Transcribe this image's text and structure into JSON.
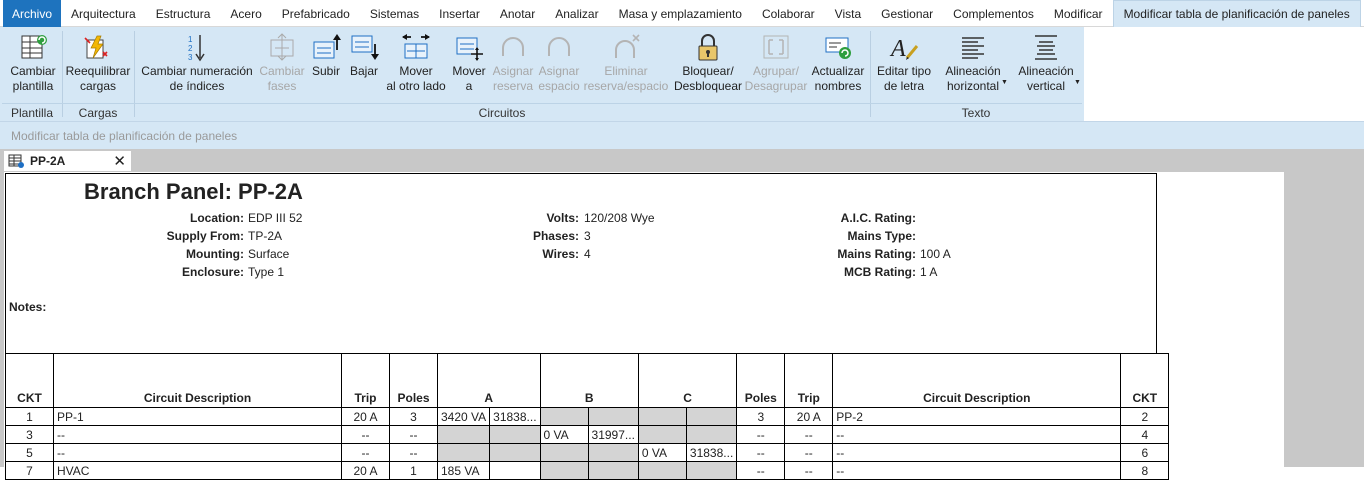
{
  "menu": {
    "tabs": [
      "Archivo",
      "Arquitectura",
      "Estructura",
      "Acero",
      "Prefabricado",
      "Sistemas",
      "Insertar",
      "Anotar",
      "Analizar",
      "Masa y emplazamiento",
      "Colaborar",
      "Vista",
      "Gestionar",
      "Complementos",
      "Modificar",
      "Modificar tabla de planificación de paneles"
    ]
  },
  "ribbon": {
    "buttons": {
      "cambiar_plantilla": [
        "Cambiar",
        "plantilla"
      ],
      "reequilibrar": [
        "Reequilibrar",
        "cargas"
      ],
      "cambiar_numeracion": [
        "Cambiar numeración",
        "de índices"
      ],
      "cambiar_fases": [
        "Cambiar",
        "fases"
      ],
      "subir": [
        "Subir"
      ],
      "bajar": [
        "Bajar"
      ],
      "mover_otro_lado": [
        "Mover",
        "al otro lado"
      ],
      "mover_a": [
        "Mover",
        "a"
      ],
      "asignar_reserva": [
        "Asignar",
        "reserva"
      ],
      "asignar_espacio": [
        "Asignar",
        "espacio"
      ],
      "eliminar_reserva": [
        "Eliminar",
        "reserva/espacio"
      ],
      "bloquear": [
        "Bloquear/",
        "Desbloquear"
      ],
      "agrupar": [
        "Agrupar/",
        "Desagrupar"
      ],
      "actualizar": [
        "Actualizar",
        "nombres"
      ],
      "editar_tipo": [
        "Editar tipo",
        "de letra"
      ],
      "alin_horizontal": [
        "Alineación",
        "horizontal"
      ],
      "alin_vertical": [
        "Alineación",
        "vertical"
      ]
    },
    "panels": {
      "plantilla": "Plantilla",
      "cargas": "Cargas",
      "circuitos": "Circuitos",
      "texto": "Texto"
    }
  },
  "context_bar": "Modificar tabla de planificación de paneles",
  "doc_tab": {
    "title": "PP-2A",
    "close": "✕"
  },
  "panel": {
    "title": "Branch Panel: PP-2A",
    "fields": {
      "location": {
        "label": "Location:",
        "value": "EDP III 52"
      },
      "supply_from": {
        "label": "Supply From:",
        "value": "TP-2A"
      },
      "mounting": {
        "label": "Mounting:",
        "value": "Surface"
      },
      "enclosure": {
        "label": "Enclosure:",
        "value": "Type 1"
      },
      "volts": {
        "label": "Volts:",
        "value": "120/208 Wye"
      },
      "phases": {
        "label": "Phases:",
        "value": "3"
      },
      "wires": {
        "label": "Wires:",
        "value": "4"
      },
      "aic": {
        "label": "A.I.C. Rating:",
        "value": ""
      },
      "mains_type": {
        "label": "Mains Type:",
        "value": ""
      },
      "mains_rating": {
        "label": "Mains Rating:",
        "value": "100 A"
      },
      "mcb_rating": {
        "label": "MCB Rating:",
        "value": "1 A"
      }
    },
    "notes_label": "Notes:"
  },
  "table": {
    "headers": {
      "ckt_l": "CKT",
      "desc_l": "Circuit Description",
      "trip_l": "Trip",
      "poles_l": "Poles",
      "a": "A",
      "b": "B",
      "c": "C",
      "poles_r": "Poles",
      "trip_r": "Trip",
      "desc_r": "Circuit Description",
      "ckt_r": "CKT"
    },
    "rows": [
      {
        "ckt_l": "1",
        "desc_l": "PP-1",
        "trip_l": "20 A",
        "poles_l": "3",
        "a1": "3420 VA",
        "a2": "31838...",
        "b1": "",
        "b2": "",
        "c1": "",
        "c2": "",
        "poles_r": "3",
        "trip_r": "20 A",
        "desc_r": "PP-2",
        "ckt_r": "2"
      },
      {
        "ckt_l": "3",
        "desc_l": "--",
        "trip_l": "--",
        "poles_l": "--",
        "a1": "",
        "a2": "",
        "b1": "0 VA",
        "b2": "31997...",
        "c1": "",
        "c2": "",
        "poles_r": "--",
        "trip_r": "--",
        "desc_r": "--",
        "ckt_r": "4"
      },
      {
        "ckt_l": "5",
        "desc_l": "--",
        "trip_l": "--",
        "poles_l": "--",
        "a1": "",
        "a2": "",
        "b1": "",
        "b2": "",
        "c1": "0 VA",
        "c2": "31838...",
        "poles_r": "--",
        "trip_r": "--",
        "desc_r": "--",
        "ckt_r": "6"
      },
      {
        "ckt_l": "7",
        "desc_l": "HVAC",
        "trip_l": "20 A",
        "poles_l": "1",
        "a1": "185 VA",
        "a2": "",
        "b1": "",
        "b2": "",
        "c1": "",
        "c2": "",
        "poles_r": "--",
        "trip_r": "--",
        "desc_r": "--",
        "ckt_r": "8"
      }
    ]
  }
}
